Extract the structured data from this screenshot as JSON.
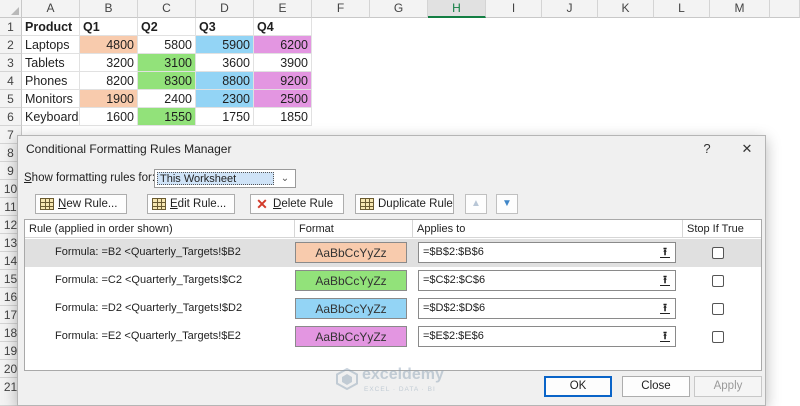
{
  "sheet": {
    "columns": [
      "A",
      "B",
      "C",
      "D",
      "E",
      "F",
      "G",
      "H",
      "I",
      "J",
      "K",
      "L",
      "M"
    ],
    "selected_column": "H",
    "row_numbers": [
      "1",
      "2",
      "3",
      "4",
      "5",
      "6",
      "7",
      "8",
      "9",
      "10",
      "11",
      "12",
      "13",
      "14",
      "15",
      "16",
      "17",
      "18",
      "19",
      "20",
      "21"
    ],
    "rows": [
      [
        "Product",
        "Q1",
        "Q2",
        "Q3",
        "Q4"
      ],
      [
        "Laptops",
        "4800",
        "5800",
        "5900",
        "6200"
      ],
      [
        "Tablets",
        "3200",
        "3100",
        "3600",
        "3900"
      ],
      [
        "Phones",
        "8200",
        "8300",
        "8800",
        "9200"
      ],
      [
        "Monitors",
        "1900",
        "2400",
        "2300",
        "2500"
      ],
      [
        "Keyboards",
        "1600",
        "1550",
        "1750",
        "1850"
      ]
    ],
    "highlight_colors": {
      "q1": "#f8cbad",
      "q2": "#92e27a",
      "q3": "#93d4f5",
      "q4": "#e396e1"
    }
  },
  "dialog": {
    "title": "Conditional Formatting Rules Manager",
    "help_glyph": "?",
    "close_glyph": "✕",
    "show_label_prefix": "S",
    "show_label_rest": "how formatting rules for:",
    "show_value": "This Worksheet",
    "toolbar": {
      "new_rule_u": "N",
      "new_rule_rest": "ew Rule...",
      "edit_rule_u": "E",
      "edit_rule_rest": "dit Rule...",
      "delete_rule_u": "D",
      "delete_rule_rest": "elete Rule",
      "duplicate_rule": "Duplicate Rule",
      "move_up_glyph": "▲",
      "move_down_glyph": "▼"
    },
    "columns": {
      "rule": "Rule (applied in order shown)",
      "format": "Format",
      "applies": "Applies to",
      "stop": "Stop If True"
    },
    "rules": [
      {
        "formula": "Formula: =B2 <Quarterly_Targets!$B2",
        "preview": "AaBbCcYyZz",
        "color": "#f8cbad",
        "applies_to": "=$B$2:$B$6",
        "stop_if_true": false,
        "selected": true
      },
      {
        "formula": "Formula: =C2 <Quarterly_Targets!$C2",
        "preview": "AaBbCcYyZz",
        "color": "#92e27a",
        "applies_to": "=$C$2:$C$6",
        "stop_if_true": false,
        "selected": false
      },
      {
        "formula": "Formula: =D2 <Quarterly_Targets!$D2",
        "preview": "AaBbCcYyZz",
        "color": "#93d4f5",
        "applies_to": "=$D$2:$D$6",
        "stop_if_true": false,
        "selected": false
      },
      {
        "formula": "Formula: =E2 <Quarterly_Targets!$E2",
        "preview": "AaBbCcYyZz",
        "color": "#e396e1",
        "applies_to": "=$E$2:$E$6",
        "stop_if_true": false,
        "selected": false
      }
    ],
    "collapse_glyph": "⭱",
    "buttons": {
      "ok": "OK",
      "close": "Close",
      "apply": "Apply"
    },
    "watermark": {
      "name": "exceldemy",
      "tagline": "EXCEL · DATA · BI"
    }
  }
}
